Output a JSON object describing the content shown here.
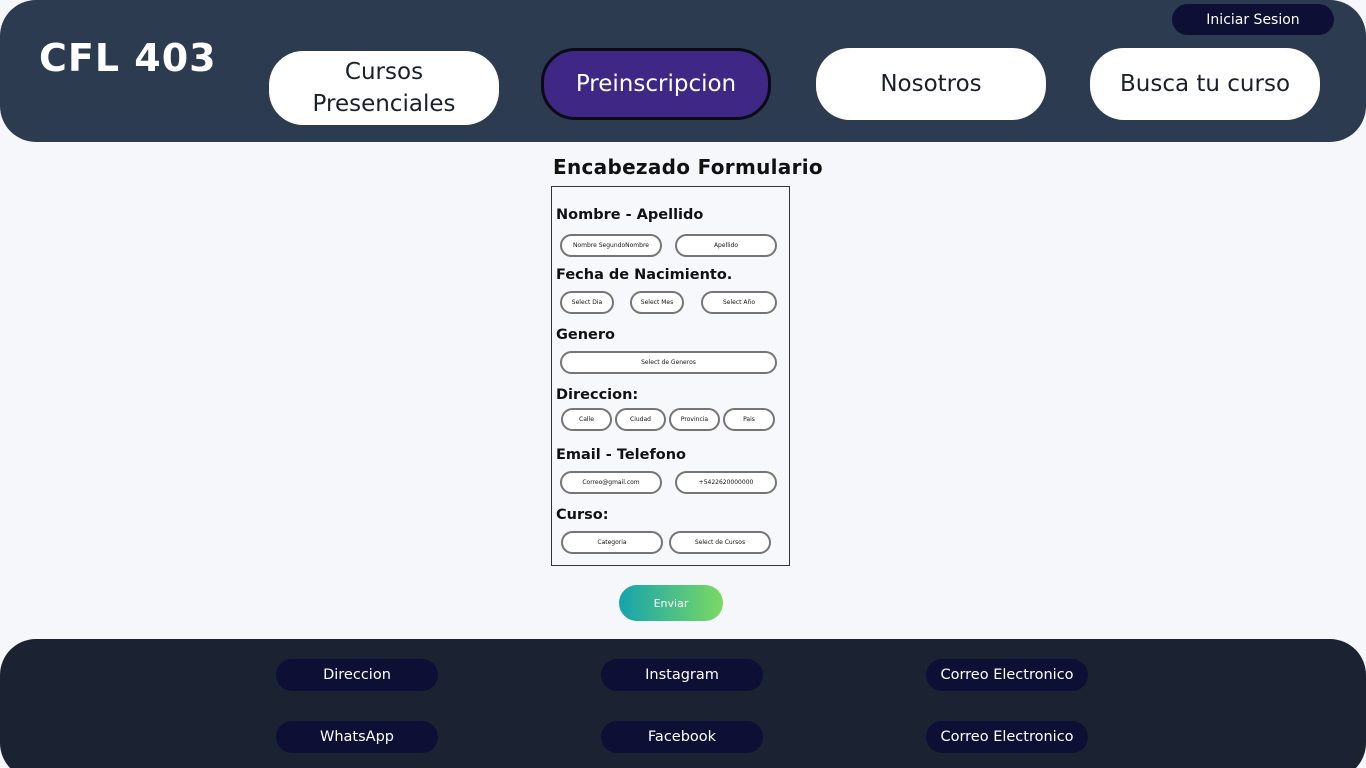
{
  "header": {
    "logo": "CFL 403",
    "login_label": "Iniciar Sesion",
    "nav": [
      {
        "label": "Cursos Presenciales"
      },
      {
        "label": "Preinscripcion"
      },
      {
        "label": "Nosotros"
      },
      {
        "label": "Busca tu curso"
      }
    ]
  },
  "form": {
    "title": "Encabezado Formulario",
    "sections": {
      "name": {
        "label": "Nombre - Apellido",
        "first_name": "Nombre SegundoNombre",
        "last_name": "Apellido"
      },
      "birth": {
        "label": "Fecha de Nacimiento.",
        "day": "Select Dia",
        "month": "Select Mes",
        "year": "Select Año"
      },
      "gender": {
        "label": "Genero",
        "select": "Select de Generos"
      },
      "address": {
        "label": "Direccion:",
        "street": "Calle",
        "city": "Ciudad",
        "province": "Provincia",
        "country": "Pais"
      },
      "contact": {
        "label": "Email - Telefono",
        "email": "Correo@gmail.com",
        "phone": "+5422620000000"
      },
      "course": {
        "label": "Curso:",
        "category": "Categoria",
        "select": "Select de Cursos"
      }
    },
    "submit_label": "Enviar"
  },
  "footer": {
    "links": [
      {
        "label": "Direccion"
      },
      {
        "label": "Instagram"
      },
      {
        "label": "Correo Electronico"
      },
      {
        "label": "WhatsApp"
      },
      {
        "label": "Facebook"
      },
      {
        "label": "Correo Electronico"
      }
    ]
  },
  "colors": {
    "header_bg": "#2d3b50",
    "footer_bg": "#1b2332",
    "active_nav": "#3f2785",
    "dark_button": "#0d1034",
    "submit_gradient_start": "#16a3ad",
    "submit_gradient_end": "#7bd963"
  }
}
